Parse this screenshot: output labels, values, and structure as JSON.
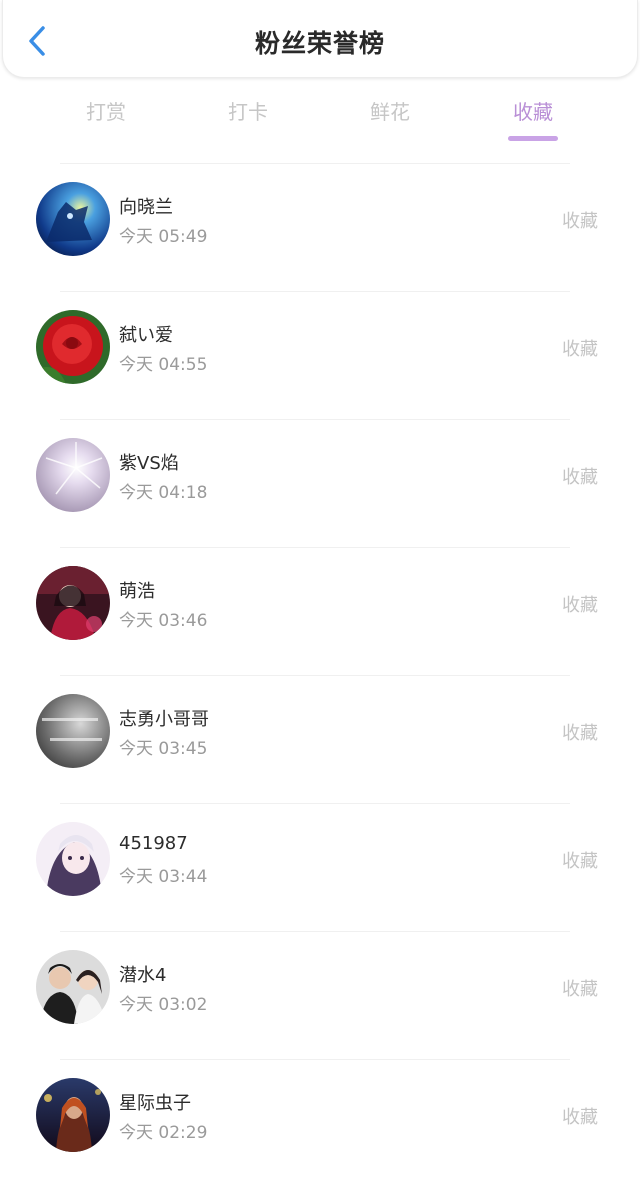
{
  "header": {
    "title": "粉丝荣誉榜",
    "back_icon": "chevron-left-icon",
    "accent_color": "#3a8ee6"
  },
  "tabs": [
    {
      "label": "打赏",
      "active": false
    },
    {
      "label": "打卡",
      "active": false
    },
    {
      "label": "鲜花",
      "active": false
    },
    {
      "label": "收藏",
      "active": true
    }
  ],
  "active_tab_color": "#c9a3e6",
  "fans": [
    {
      "name": "向晓兰",
      "time": "今天 05:49",
      "action": "收藏",
      "avatar": "wolf-night-avatar"
    },
    {
      "name": "弑い爱",
      "time": "今天 04:55",
      "action": "收藏",
      "avatar": "red-rose-avatar"
    },
    {
      "name": "紫VS焰",
      "time": "今天 04:18",
      "action": "收藏",
      "avatar": "light-burst-avatar"
    },
    {
      "name": "萌浩",
      "time": "今天 03:46",
      "action": "收藏",
      "avatar": "costume-portrait-avatar"
    },
    {
      "name": "志勇小哥哥",
      "time": "今天 03:45",
      "action": "收藏",
      "avatar": "gray-text-avatar"
    },
    {
      "name": "451987",
      "time": "今天 03:44",
      "action": "收藏",
      "avatar": "anime-girl-avatar"
    },
    {
      "name": "潜水4",
      "time": "今天 03:02",
      "action": "收藏",
      "avatar": "couple-photo-avatar"
    },
    {
      "name": "星际虫子",
      "time": "今天 02:29",
      "action": "收藏",
      "avatar": "fantasy-warrior-avatar"
    }
  ]
}
